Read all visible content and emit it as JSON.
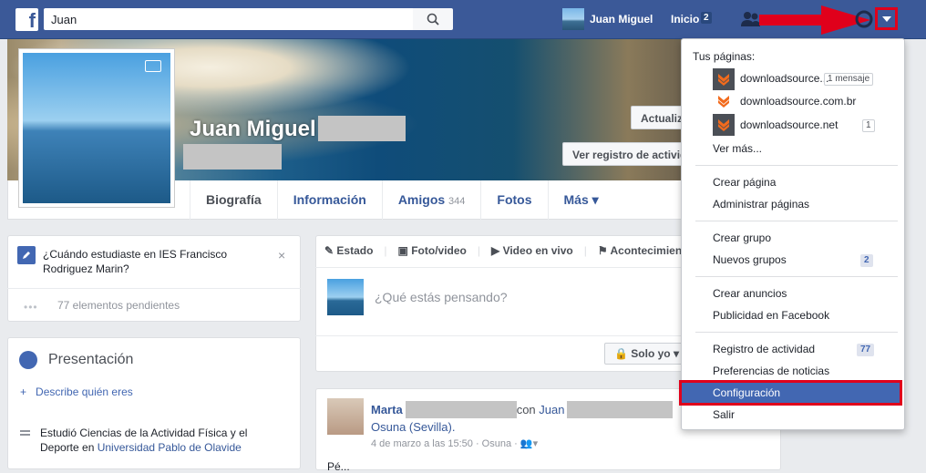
{
  "topbar": {
    "logo": "f",
    "search_value": "Juan",
    "user_name": "Juan Miguel",
    "home_label": "Inicio",
    "home_count": "2"
  },
  "profile": {
    "name": "Juan Miguel",
    "update_label": "Actualizar información",
    "activity_label": "Ver registro de actividad",
    "tabs": [
      {
        "label": "Biografía"
      },
      {
        "label": "Información"
      },
      {
        "label": "Amigos",
        "count": "344"
      },
      {
        "label": "Fotos"
      },
      {
        "label": "Más ▾"
      }
    ]
  },
  "prompt": {
    "text": "¿Cuándo estudiaste en IES Francisco Rodriguez Marin?",
    "close": "×",
    "pending_dots": "•••",
    "pending": "77 elementos pendientes"
  },
  "intro": {
    "title": "Presentación",
    "describe": "Describe quién eres",
    "study_prefix": "Estudió Ciencias de la Actividad Física y el Deporte en ",
    "study_link": "Universidad Pablo de Olavide"
  },
  "composer": {
    "tabs": [
      "Estado",
      "Foto/video",
      "Video en vivo",
      "Acontecimiento"
    ],
    "placeholder": "¿Qué estás pensando?",
    "privacy": "Solo yo ▾"
  },
  "post": {
    "author": "Marta",
    "with": "con",
    "with_name": "Juan",
    "place": "Osuna (Sevilla).",
    "meta": "4 de marzo a las 15:50 · Osuna ·",
    "body_partial": "Pé..."
  },
  "menu": {
    "your_pages": "Tus páginas:",
    "pages": [
      {
        "name": "downloadsource...",
        "badge": "1 mensaje"
      },
      {
        "name": "downloadsource.com.br",
        "badge": ""
      },
      {
        "name": "downloadsource.net",
        "badge": "1"
      }
    ],
    "see_more": "Ver más...",
    "create_page": "Crear página",
    "manage_pages": "Administrar páginas",
    "create_group": "Crear grupo",
    "new_groups": "Nuevos grupos",
    "new_groups_count": "2",
    "create_ads": "Crear anuncios",
    "advertising": "Publicidad en Facebook",
    "activity_log": "Registro de actividad",
    "activity_count": "77",
    "news_prefs": "Preferencias de noticias",
    "settings": "Configuración",
    "logout": "Salir"
  },
  "colors": {
    "brand": "#3b5998",
    "highlight": "#e0001b",
    "menu_selected": "#4267b2"
  }
}
